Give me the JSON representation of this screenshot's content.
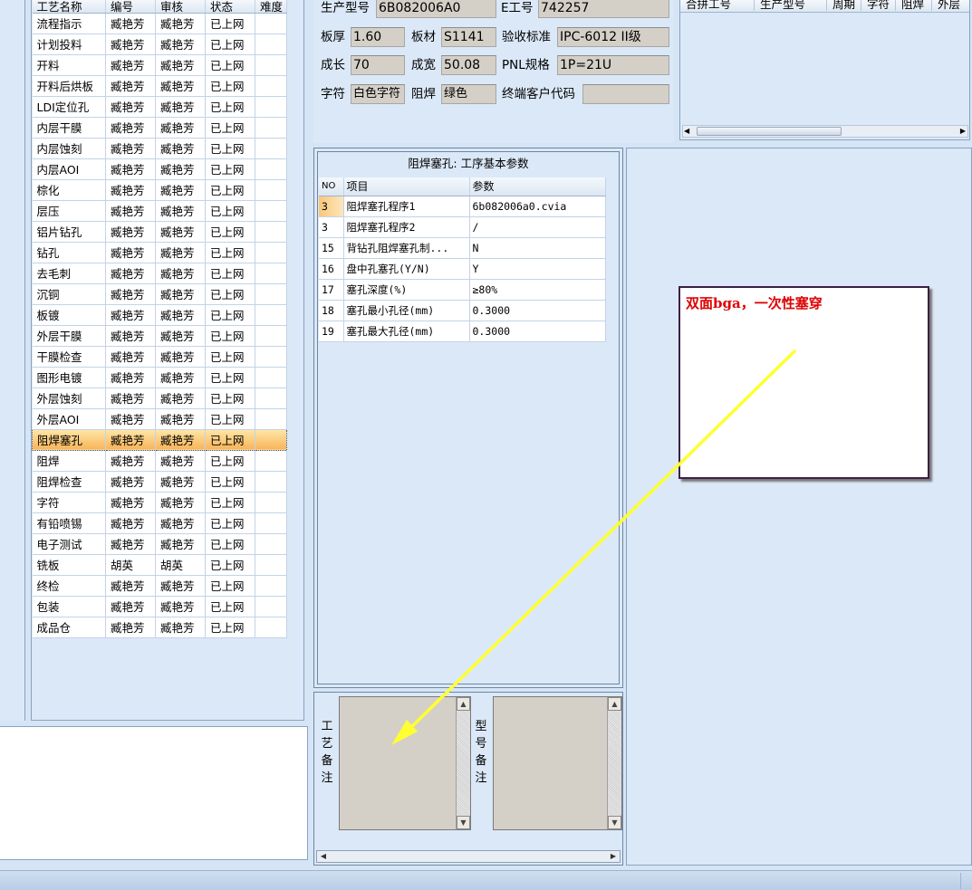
{
  "process_table": {
    "columns": [
      "工艺名称",
      "编号",
      "审核",
      "状态",
      "难度"
    ],
    "rows": [
      [
        "流程指示",
        "臧艳芳",
        "臧艳芳",
        "已上网",
        ""
      ],
      [
        "计划投料",
        "臧艳芳",
        "臧艳芳",
        "已上网",
        ""
      ],
      [
        "开料",
        "臧艳芳",
        "臧艳芳",
        "已上网",
        ""
      ],
      [
        "开料后烘板",
        "臧艳芳",
        "臧艳芳",
        "已上网",
        ""
      ],
      [
        "LDI定位孔",
        "臧艳芳",
        "臧艳芳",
        "已上网",
        ""
      ],
      [
        "内层干膜",
        "臧艳芳",
        "臧艳芳",
        "已上网",
        ""
      ],
      [
        "内层蚀刻",
        "臧艳芳",
        "臧艳芳",
        "已上网",
        ""
      ],
      [
        "内层AOI",
        "臧艳芳",
        "臧艳芳",
        "已上网",
        ""
      ],
      [
        "棕化",
        "臧艳芳",
        "臧艳芳",
        "已上网",
        ""
      ],
      [
        "层压",
        "臧艳芳",
        "臧艳芳",
        "已上网",
        ""
      ],
      [
        "铝片钻孔",
        "臧艳芳",
        "臧艳芳",
        "已上网",
        ""
      ],
      [
        "钻孔",
        "臧艳芳",
        "臧艳芳",
        "已上网",
        ""
      ],
      [
        "去毛刺",
        "臧艳芳",
        "臧艳芳",
        "已上网",
        ""
      ],
      [
        "沉铜",
        "臧艳芳",
        "臧艳芳",
        "已上网",
        ""
      ],
      [
        "板镀",
        "臧艳芳",
        "臧艳芳",
        "已上网",
        ""
      ],
      [
        "外层干膜",
        "臧艳芳",
        "臧艳芳",
        "已上网",
        ""
      ],
      [
        "干膜检查",
        "臧艳芳",
        "臧艳芳",
        "已上网",
        ""
      ],
      [
        "图形电镀",
        "臧艳芳",
        "臧艳芳",
        "已上网",
        ""
      ],
      [
        "外层蚀刻",
        "臧艳芳",
        "臧艳芳",
        "已上网",
        ""
      ],
      [
        "外层AOI",
        "臧艳芳",
        "臧艳芳",
        "已上网",
        ""
      ],
      [
        "阻焊塞孔",
        "臧艳芳",
        "臧艳芳",
        "已上网",
        ""
      ],
      [
        "阻焊",
        "臧艳芳",
        "臧艳芳",
        "已上网",
        ""
      ],
      [
        "阻焊检查",
        "臧艳芳",
        "臧艳芳",
        "已上网",
        ""
      ],
      [
        "字符",
        "臧艳芳",
        "臧艳芳",
        "已上网",
        ""
      ],
      [
        "有铅喷锡",
        "臧艳芳",
        "臧艳芳",
        "已上网",
        ""
      ],
      [
        "电子测试",
        "臧艳芳",
        "臧艳芳",
        "已上网",
        ""
      ],
      [
        "铣板",
        "胡英",
        "胡英",
        "已上网",
        ""
      ],
      [
        "终检",
        "臧艳芳",
        "臧艳芳",
        "已上网",
        ""
      ],
      [
        "包装",
        "臧艳芳",
        "臧艳芳",
        "已上网",
        ""
      ],
      [
        "成品仓",
        "臧艳芳",
        "臧艳芳",
        "已上网",
        ""
      ]
    ],
    "selected_index": 20
  },
  "form": {
    "model_label": "生产型号",
    "model_value": "6B082006A0",
    "e_no_label": "E工号",
    "e_no_value": "742257",
    "thickness_label": "板厚",
    "thickness_value": "1.60",
    "material_label": "板材",
    "material_value": "S1141",
    "standard_label": "验收标准",
    "standard_value": "IPC-6012 II级",
    "length_label": "成长",
    "length_value": "70",
    "width_label": "成宽",
    "width_value": "50.08",
    "pnl_label": "PNL规格",
    "pnl_value": "1P=21U",
    "char_label": "字符",
    "char_value": "白色字符",
    "mask_label": "阻焊",
    "mask_value": "绿色",
    "customer_code_label": "终端客户代码",
    "customer_code_value": ""
  },
  "merge_table": {
    "columns": [
      "合拼工号",
      "生产型号",
      "周期",
      "字符",
      "阻焊",
      "外层"
    ]
  },
  "param_panel": {
    "title": "阻焊塞孔: 工序基本参数",
    "columns": [
      "NO",
      "项目",
      "参数"
    ],
    "rows": [
      [
        "3",
        "阻焊塞孔程序1",
        "6b082006a0.cvia"
      ],
      [
        "3",
        "阻焊塞孔程序2",
        "/"
      ],
      [
        "15",
        "背钻孔阻焊塞孔制...",
        "N"
      ],
      [
        "16",
        "盘中孔塞孔(Y/N)",
        "Y"
      ],
      [
        "17",
        "塞孔深度(%)",
        "≥80%"
      ],
      [
        "18",
        "塞孔最小孔径(mm)",
        "0.3000"
      ],
      [
        "19",
        "塞孔最大孔径(mm)",
        "0.3000"
      ]
    ]
  },
  "remarks": {
    "process_label": "工艺备注",
    "model_label": "型号备注"
  },
  "annotation": {
    "note_text": "双面bga，一次性塞穿",
    "note_color": "#e00000",
    "arrow_color": "#ffff33"
  },
  "icons": {
    "scroll_up": "▲",
    "scroll_down": "▼",
    "scroll_left": "◀",
    "scroll_right": "▶",
    "grip": "|||"
  }
}
